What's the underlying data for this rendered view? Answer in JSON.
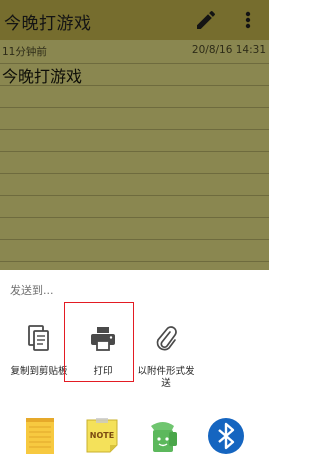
{
  "app": {
    "title": "今晚打游戏",
    "relative_time": "11分钟前",
    "datetime": "20/8/16 14:31",
    "note_text": "今晚打游戏",
    "icons": [
      "edit-pencil-icon",
      "more-vert-icon"
    ]
  },
  "share_sheet": {
    "heading": "发送到...",
    "targets": [
      {
        "label": "复制到剪贴板",
        "icon": "copy-icon"
      },
      {
        "label": "打印",
        "icon": "printer-icon"
      },
      {
        "label": "以附件形式发送",
        "icon": "paperclip-icon"
      }
    ],
    "apps": [
      {
        "icon": "notepad-app-icon"
      },
      {
        "icon": "sticky-note-app-icon",
        "text": "NOTE"
      },
      {
        "icon": "android-share-app-icon"
      },
      {
        "icon": "bluetooth-app-icon"
      }
    ],
    "colors": {
      "highlight": "#e31b23",
      "bluetooth": "#1565c0",
      "appbar": "#766d2e"
    }
  }
}
